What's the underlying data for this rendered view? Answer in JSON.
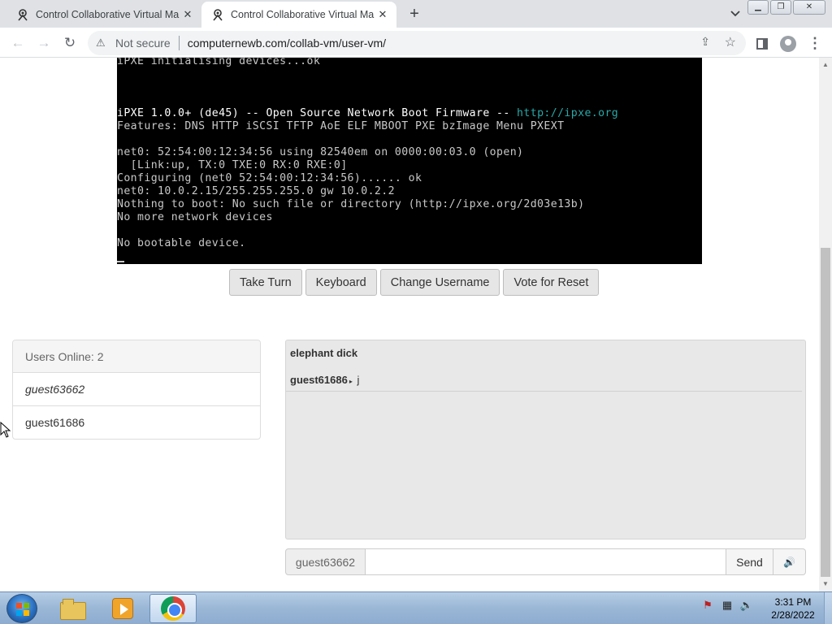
{
  "browser": {
    "tabs": [
      {
        "title": "Control Collaborative Virtual Ma",
        "active": false
      },
      {
        "title": "Control Collaborative Virtual Ma",
        "active": true
      }
    ],
    "newtab_glyph": "+",
    "security_label": "Not secure",
    "url": "computernewb.com/collab-vm/user-vm/"
  },
  "vm": {
    "lines": [
      "iPXE initialising devices...ok",
      "",
      "",
      "",
      "Features: DNS HTTP iSCSI TFTP AoE ELF MBOOT PXE bzImage Menu PXEXT",
      "",
      "net0: 52:54:00:12:34:56 using 82540em on 0000:00:03.0 (open)",
      "  [Link:up, TX:0 TXE:0 RX:0 RXE:0]",
      "Configuring (net0 52:54:00:12:34:56)...... ok",
      "net0: 10.0.2.15/255.255.255.0 gw 10.0.2.2",
      "Nothing to boot: No such file or directory (http://ipxe.org/2d03e13b)",
      "No more network devices",
      "",
      "No bootable device."
    ],
    "banner_prefix": "iPXE 1.0.0+ (de45) -- Open Source Network Boot Firmware -- ",
    "banner_link": "http://ipxe.org",
    "buttons": {
      "take_turn": "Take Turn",
      "keyboard": "Keyboard",
      "change_username": "Change Username",
      "vote_reset": "Vote for Reset"
    }
  },
  "users": {
    "header": "Users Online: 2",
    "list": [
      "guest63662",
      "guest61686"
    ]
  },
  "chat": {
    "system_message": "elephant dick",
    "messages": [
      {
        "name": "guest61686",
        "text": "j"
      }
    ],
    "username": "guest63662",
    "input_value": "",
    "send_label": "Send",
    "sound_icon": "speaker-icon"
  },
  "taskbar": {
    "time": "3:31 PM",
    "date": "2/28/2022"
  },
  "colors": {
    "vm_text": "#c8c8c8",
    "vm_link": "#2aa8a8",
    "accent": "#4285f4"
  }
}
